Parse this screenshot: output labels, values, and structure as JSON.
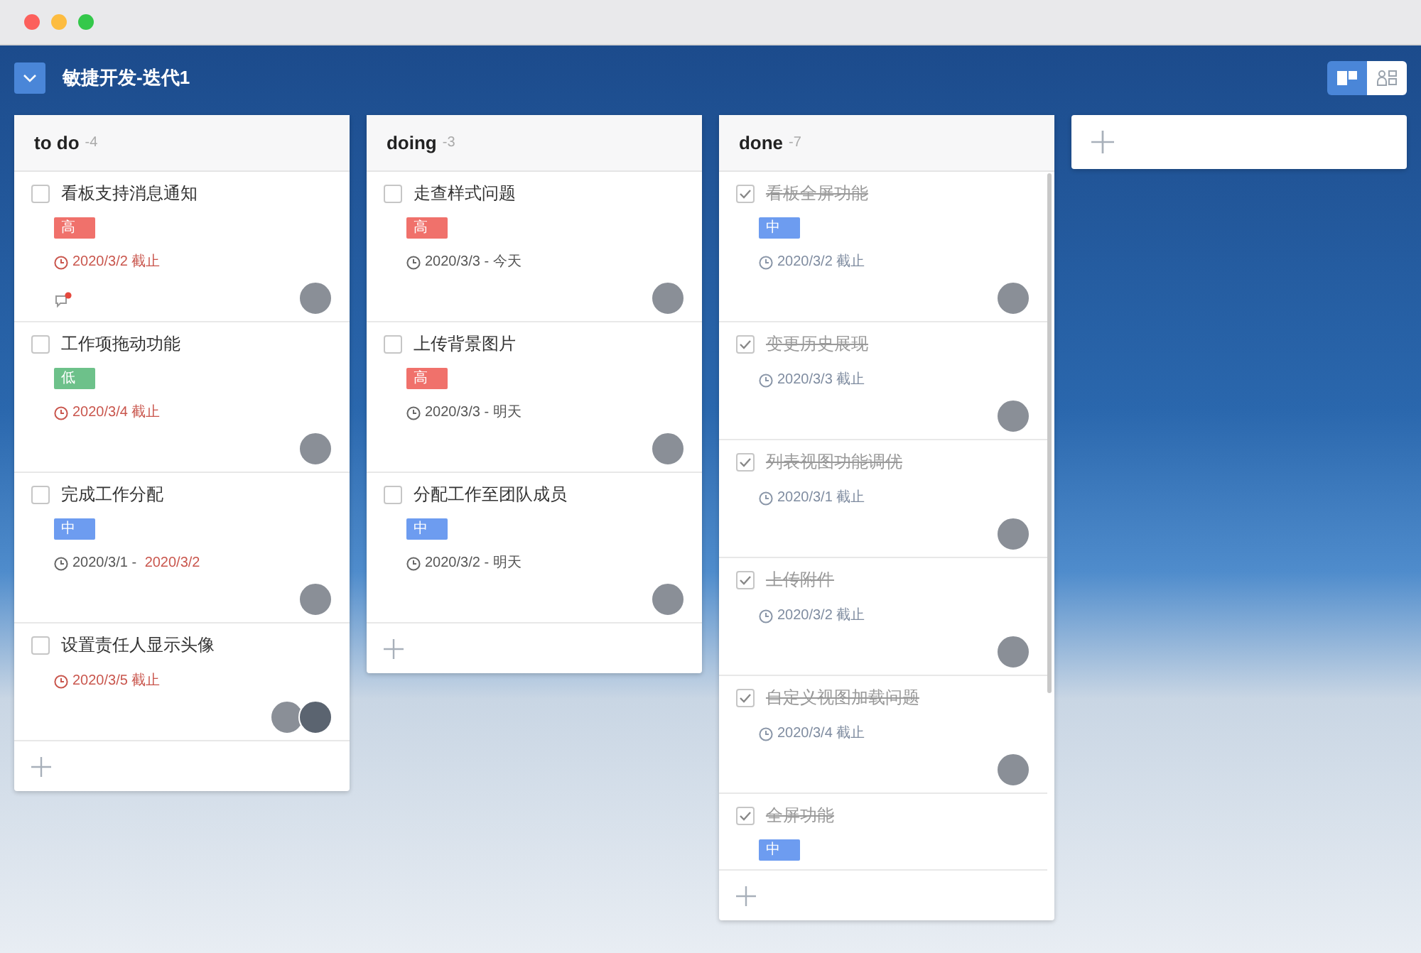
{
  "board": {
    "title": "敏捷开发-迭代1"
  },
  "views": [
    {
      "kind": "board",
      "selected": true
    },
    {
      "kind": "member",
      "selected": false
    }
  ],
  "columns": [
    {
      "name": "to do",
      "count": "-4",
      "cards": [
        {
          "title": "看板支持消息通知",
          "done": false,
          "priority": {
            "label": "高",
            "color": "#f0716b"
          },
          "due": [
            {
              "text": "2020/3/2 截止",
              "overdue": true
            }
          ],
          "comment_unread": true,
          "assignees": [
            {
              "kind": "avatar"
            }
          ]
        },
        {
          "title": "工作项拖动功能",
          "done": false,
          "priority": {
            "label": "低",
            "color": "#6dc18a"
          },
          "due": [
            {
              "text": "2020/3/4 截止",
              "overdue": true
            }
          ],
          "assignees": [
            {
              "kind": "avatar"
            }
          ]
        },
        {
          "title": "完成工作分配",
          "done": false,
          "priority": {
            "label": "中",
            "color": "#6d9cf0"
          },
          "due": [
            {
              "text": "2020/3/1 - ",
              "overdue": false
            },
            {
              "text": "2020/3/2",
              "overdue": true
            }
          ],
          "assignees": [
            {
              "kind": "avatar"
            }
          ]
        },
        {
          "title": "设置责任人显示头像",
          "done": false,
          "due": [
            {
              "text": "2020/3/5 截止",
              "overdue": true
            }
          ],
          "assignees": [
            {
              "kind": "avatar"
            },
            {
              "kind": "avatar"
            }
          ]
        }
      ]
    },
    {
      "name": "doing",
      "count": "-3",
      "cards": [
        {
          "title": "走查样式问题",
          "done": false,
          "priority": {
            "label": "高",
            "color": "#f0716b"
          },
          "due": [
            {
              "text": "2020/3/3 - 今天",
              "overdue": false
            }
          ],
          "assignees": [
            {
              "kind": "avatar"
            }
          ]
        },
        {
          "title": "上传背景图片",
          "done": false,
          "priority": {
            "label": "高",
            "color": "#f0716b"
          },
          "due": [
            {
              "text": "2020/3/3 - 明天",
              "overdue": false
            }
          ],
          "assignees": [
            {
              "kind": "avatar"
            }
          ]
        },
        {
          "title": "分配工作至团队成员",
          "done": false,
          "priority": {
            "label": "中",
            "color": "#6d9cf0"
          },
          "due": [
            {
              "text": "2020/3/2 - 明天",
              "overdue": false
            }
          ],
          "assignees": [
            {
              "kind": "avatar"
            }
          ]
        }
      ]
    },
    {
      "name": "done",
      "count": "-7",
      "scrollable": true,
      "cards": [
        {
          "title": "看板全屏功能",
          "done": true,
          "priority": {
            "label": "中",
            "color": "#6d9cf0"
          },
          "due": [
            {
              "text": "2020/3/2 截止",
              "overdue": false
            }
          ],
          "assignees": [
            {
              "kind": "avatar"
            }
          ]
        },
        {
          "title": "变更历史展现",
          "done": true,
          "due": [
            {
              "text": "2020/3/3 截止",
              "overdue": false
            }
          ],
          "assignees": [
            {
              "kind": "avatar"
            }
          ]
        },
        {
          "title": "列表视图功能调优",
          "done": true,
          "due": [
            {
              "text": "2020/3/1 截止",
              "overdue": false
            }
          ],
          "assignees": [
            {
              "kind": "avatar"
            }
          ]
        },
        {
          "title": "上传附件",
          "done": true,
          "due": [
            {
              "text": "2020/3/2 截止",
              "overdue": false
            }
          ],
          "assignees": [
            {
              "kind": "avatar"
            }
          ]
        },
        {
          "title": "自定义视图加载问题",
          "done": true,
          "due": [
            {
              "text": "2020/3/4 截止",
              "overdue": false
            }
          ],
          "assignees": [
            {
              "kind": "avatar"
            }
          ]
        },
        {
          "title": "全屏功能",
          "done": true,
          "priority": {
            "label": "中",
            "color": "#6d9cf0"
          }
        }
      ]
    }
  ]
}
